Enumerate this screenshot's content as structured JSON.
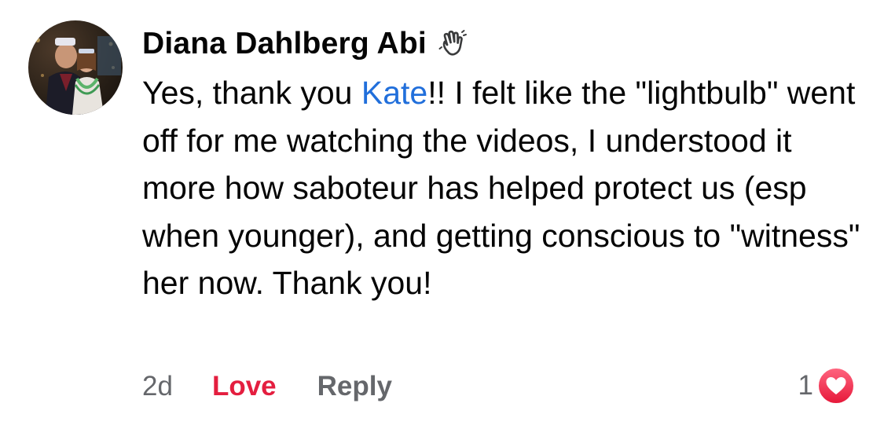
{
  "comment": {
    "author": "Diana Dahlberg Abi",
    "author_badge_icon": "waving-hand-icon",
    "avatar_icon": "profile-photo",
    "body": {
      "before_mention": "Yes, thank you ",
      "mention": "Kate",
      "after_mention": "!! I felt like the \"lightbulb\" went off for me watching the videos, I understood it more how saboteur has helped protect us (esp when younger), and getting conscious to \"witness\" her now. Thank you!"
    },
    "timestamp": "2d",
    "actions": {
      "love_label": "Love",
      "reply_label": "Reply"
    },
    "reactions": {
      "count": "1",
      "icon": "love-heart-icon"
    }
  },
  "colors": {
    "text": "#050505",
    "mention": "#216fdb",
    "love": "#e41e3f",
    "secondary": "#65676b",
    "heart_badge": "#f33e58"
  }
}
